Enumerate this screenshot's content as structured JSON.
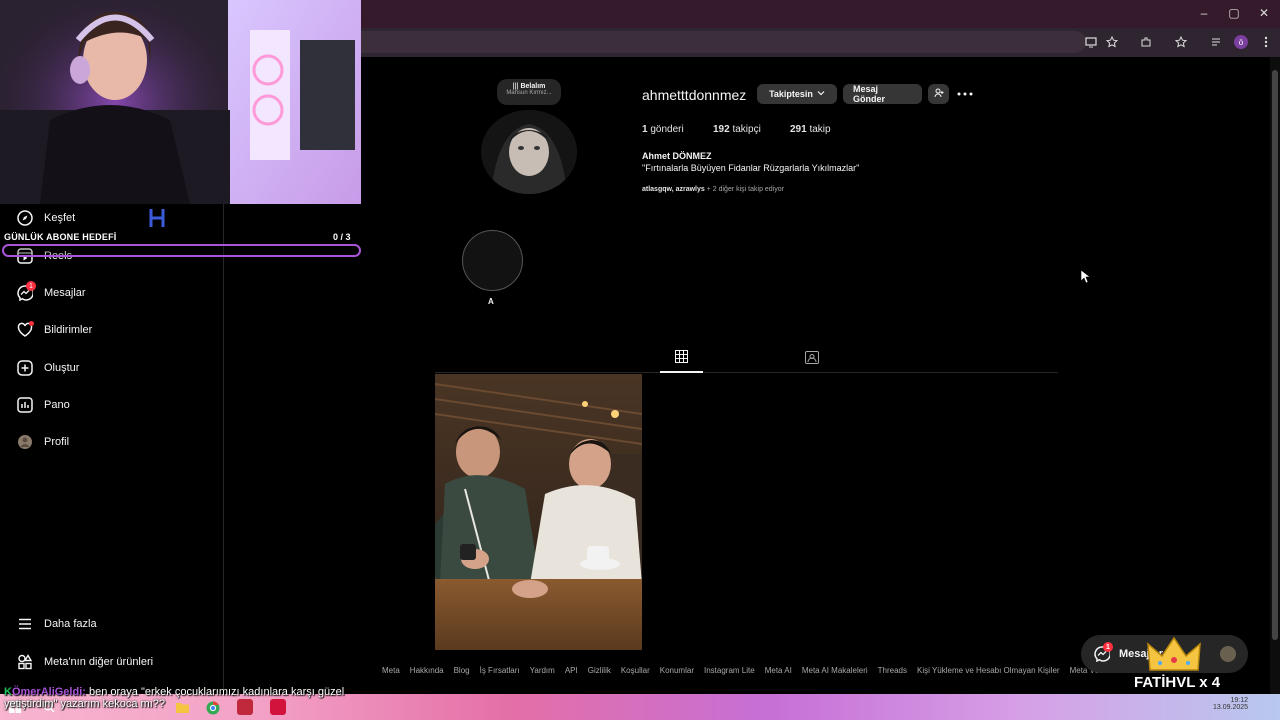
{
  "browser": {
    "window_controls": [
      "–",
      "▢",
      "✕"
    ],
    "profile_badge": "ö"
  },
  "stream_overlay": {
    "goal_title": "GÜNLÜK ABONE HEDEFİ",
    "goal_count": "0 / 3",
    "chat_prefix": "K",
    "chat_user": "ÖmerAliGeldi:",
    "chat_message_line1": "ben oraya \"erkek çocuklarımızı kadınlara karşı güzel",
    "chat_message_line2": "yetiştirdim\" yazarım kekoca mı??",
    "sub_banner": "FATİHVL x 4",
    "accent_color": "#a855d8"
  },
  "sidebar": {
    "items": [
      {
        "label": "Keşfet",
        "icon": "compass-icon"
      },
      {
        "label": "Reels",
        "icon": "reels-icon"
      },
      {
        "label": "Mesajlar",
        "icon": "messenger-icon",
        "badge": "1"
      },
      {
        "label": "Bildirimler",
        "icon": "heart-icon"
      },
      {
        "label": "Oluştur",
        "icon": "plus-square-icon"
      },
      {
        "label": "Pano",
        "icon": "chart-icon"
      },
      {
        "label": "Profil",
        "icon": "avatar-icon"
      }
    ],
    "more_label": "Daha fazla",
    "meta_products_label": "Meta'nın diğer ürünleri"
  },
  "profile": {
    "note_line1": "Belalım",
    "note_line2": "Mahsun Kırmız...",
    "username": "ahmetttdonnmez",
    "following_button": "Takiptesin",
    "message_button": "Mesaj Gönder",
    "posts_count": "1",
    "posts_label": "gönderi",
    "followers_count": "192",
    "followers_label": "takipçi",
    "following_count": "291",
    "following_label": "takip",
    "full_name": "Ahmet DÖNMEZ",
    "bio": "\"Fırtınalarla Büyüyen Fidanlar Rüzgarlarla Yıkılmazlar\"",
    "followed_by_users": "atlasgqw, azrawlys",
    "followed_by_rest": "+ 2 diğer kişi takip ediyor",
    "highlight_label": "A"
  },
  "footer_links": [
    "Meta",
    "Hakkında",
    "Blog",
    "İş Fırsatları",
    "Yardım",
    "API",
    "Gizlilik",
    "Koşullar",
    "Konumlar",
    "Instagram Lite",
    "Meta AI",
    "Meta AI Makaleleri",
    "Threads",
    "Kişi Yükleme ve Hesabı Olmayan Kişiler",
    "Meta Verified"
  ],
  "floating_messages": {
    "label": "Mesajlar",
    "badge": "1"
  },
  "taskbar": {
    "time": "19:12",
    "date": "13.09.2025"
  }
}
